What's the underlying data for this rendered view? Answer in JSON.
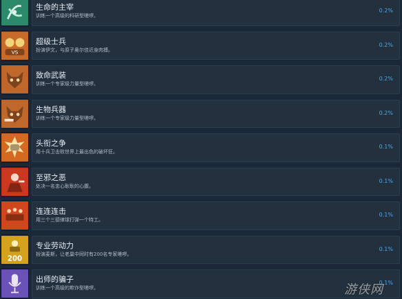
{
  "colors": {
    "background": "#1b2838",
    "row": "#23313f",
    "title": "#e8eef4",
    "description": "#b3bcc6",
    "percent": "#4fa6e5"
  },
  "achievements": [
    {
      "title": "生命的主宰",
      "description": "训练一个高级的科研型嗟啰。",
      "percent": "0.2%",
      "icon": "dna-science-icon",
      "badge_color": "#2c8a6a"
    },
    {
      "title": "超级士兵",
      "description": "扮演伊文，与原子奥尔佳近身肉搏。",
      "percent": "0.2%",
      "icon": "super-soldier-icon",
      "badge_color": "#c86b2a"
    },
    {
      "title": "致命武装",
      "description": "训练一个专家级力量型嗟啰。",
      "percent": "0.2%",
      "icon": "fox-mask-icon",
      "badge_color": "#c0682c"
    },
    {
      "title": "生物兵器",
      "description": "训练一个专家级力量型嗟啰。",
      "percent": "0.2%",
      "icon": "fox-weapon-icon",
      "badge_color": "#c0682c"
    },
    {
      "title": "头衔之争",
      "description": "用十兵卫击败世界上最出色的破坏狂。",
      "percent": "0.1%",
      "icon": "fist-punch-icon",
      "badge_color": "#d46a22"
    },
    {
      "title": "至邪之恶",
      "description": "处决一名忠心耿耿的心腹。",
      "percent": "0.1%",
      "icon": "evil-villain-icon",
      "badge_color": "#c9381f"
    },
    {
      "title": "连连连击",
      "description": "用三个三德律球打弹一个特工。",
      "percent": "0.1%",
      "icon": "combo-strike-icon",
      "badge_color": "#d0461d"
    },
    {
      "title": "专业劳动力",
      "description": "扮演麦斯，让老巢中同时有200名专家嗟啰。",
      "percent": "0.1%",
      "icon": "worker-200-icon",
      "badge_color": "#d4a21c",
      "badge_text": "200"
    },
    {
      "title": "出师的骗子",
      "description": "训练一个高级的欺诈型嗟啰。",
      "percent": "0.1%",
      "icon": "microphone-icon",
      "badge_color": "#6b52b8"
    }
  ],
  "watermark": {
    "text": "游侠网"
  }
}
